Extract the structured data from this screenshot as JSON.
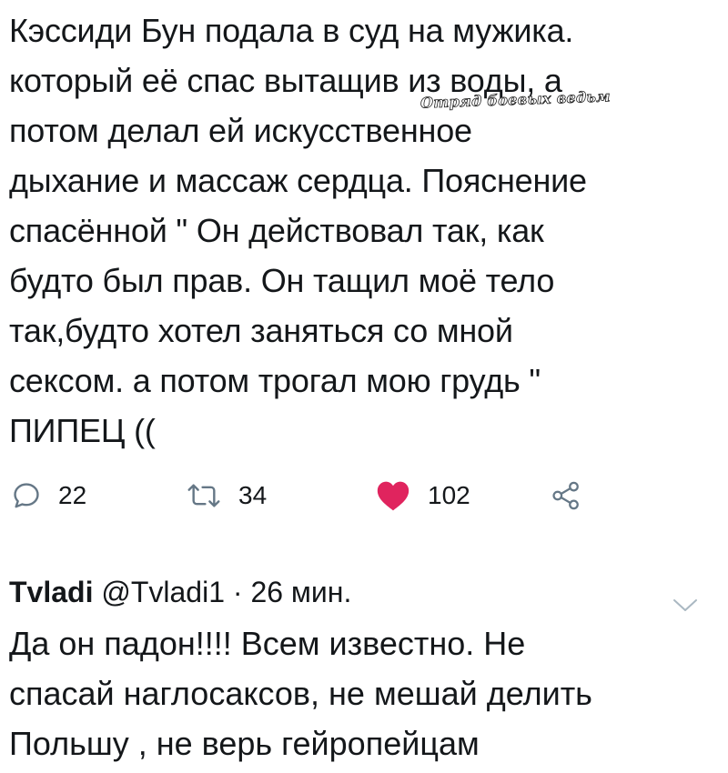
{
  "tweet": {
    "text": "Кэссиди Бун подала в суд на мужика.\nкоторый её спас вытащив из воды, а\nпотом делал ей искусственное\nдыхание и массаж сердца. Пояснение\nспасённой \" Он действовал так, как\nбудто был прав. Он тащил моё тело\nтак,будто хотел заняться со мной\nсексом. а потом трогал мою грудь \"\nПИПЕЦ ((",
    "watermark": "Отряд боевых ведьм"
  },
  "actions": {
    "replies": "22",
    "retweets": "34",
    "likes": "102",
    "icons": {
      "reply": "reply-icon",
      "retweet": "retweet-icon",
      "like": "heart-icon",
      "share": "share-icon"
    },
    "like_color": "#e0245e",
    "icon_color": "#657786"
  },
  "reply": {
    "name": "Tvladi",
    "handle": "@Tvladi1",
    "separator": "·",
    "time": "26 мин.",
    "text": "Да он падон!!!! Всем известно. Не\nспасай наглосаксов, не мешай делить\nПольшу , не верь гейропейцам"
  }
}
